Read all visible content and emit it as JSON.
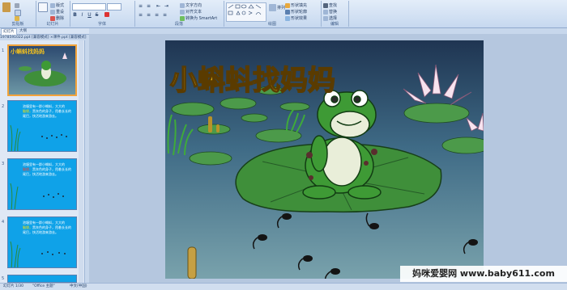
{
  "ribbon": {
    "groups": [
      "剪贴板",
      "幻灯片",
      "字体",
      "段落",
      "绘图",
      "编辑"
    ],
    "buttons": {
      "layout": "版式",
      "reset": "重设",
      "delete": "删除",
      "new_slide": "新建\n幻灯片",
      "text_direction": "文字方向",
      "align_text": "对齐文本",
      "convert_smartart": "转换为 SmartArt",
      "arrange": "排列",
      "quick_styles": "快速样式",
      "shape_fill": "形状填充",
      "shape_outline": "形状轮廓",
      "shape_effects": "形状效果",
      "find": "查找",
      "replace": "替换",
      "select": "选择"
    }
  },
  "tabs": [
    "幻灯片",
    "大纲"
  ],
  "document_titles": "1978591022.ppt [兼容模式]  ×课件.ppt [兼容模式]",
  "slides_panel": {
    "thumbs": [
      {
        "num": "1",
        "title": "小蝌蚪找妈妈"
      },
      {
        "num": "2"
      },
      {
        "num": "3"
      },
      {
        "num": "4"
      },
      {
        "num": "5"
      }
    ],
    "thumb_text": {
      "line1": "池塘里有一群小蝌蚪，大大的",
      "line2a": "脑袋，",
      "line2b": "黑灰色的身子，甩着长长的",
      "line3": "尾巴，快活地游来游去。"
    }
  },
  "slide": {
    "title": "小蝌蚪找妈妈"
  },
  "status": {
    "slide_count": "幻灯片 1/30",
    "theme": "\"Office 主题\"",
    "language": "中文(中国)"
  },
  "watermark": "妈咪爱婴网 www.baby611.com",
  "colors": {
    "ribbon_top": "#e3edf9",
    "thumb_blue": "#0fa2e8",
    "slide_title": "#f6c21c",
    "pond_top": "#2d4a70",
    "pond_bottom": "#6d98a6",
    "leaf_green": "#3f8f3a",
    "frog_green": "#3e9a35"
  }
}
